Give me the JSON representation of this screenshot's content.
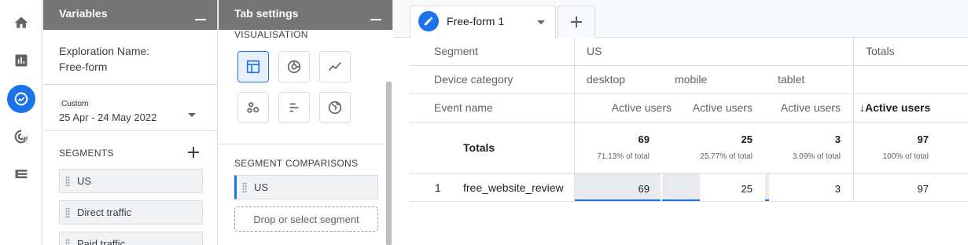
{
  "nav": {
    "items": [
      {
        "name": "home-icon"
      },
      {
        "name": "reports-icon"
      },
      {
        "name": "explore-icon",
        "active": true
      },
      {
        "name": "advertising-icon"
      },
      {
        "name": "configure-icon"
      }
    ]
  },
  "variables": {
    "title": "Variables",
    "exploration_name_label": "Exploration Name:",
    "exploration_name": "Free-form",
    "date_badge": "Custom",
    "date_range": "25 Apr - 24 May 2022",
    "segments_title": "SEGMENTS",
    "segments": [
      "US",
      "Direct traffic",
      "Paid traffic"
    ]
  },
  "tab_settings": {
    "title": "Tab settings",
    "visualisation_label": "VISUALISATION",
    "viz_buttons": [
      {
        "name": "table-viz-icon",
        "active": true
      },
      {
        "name": "donut-viz-icon"
      },
      {
        "name": "line-viz-icon"
      },
      {
        "name": "scatter-viz-icon"
      },
      {
        "name": "bar-viz-icon"
      },
      {
        "name": "geo-viz-icon"
      }
    ],
    "segment_comparisons_title": "SEGMENT COMPARISONS",
    "segment_comparison": "US",
    "drop_zone": "Drop or select segment"
  },
  "canvas": {
    "tab_label": "Free-form 1",
    "accent": "#1a73e8"
  },
  "table": {
    "row_dims": {
      "segment_label": "Segment",
      "device_label": "Device category",
      "event_label": "Event name"
    },
    "segment_value": "US",
    "totals_header": "Totals",
    "devices": [
      "desktop",
      "mobile",
      "tablet"
    ],
    "metric_headers": [
      "Active users",
      "Active users",
      "Active users",
      "↓Active users"
    ],
    "totals_label": "Totals",
    "totals": [
      {
        "value": "69",
        "pct": "71.13% of total"
      },
      {
        "value": "25",
        "pct": "25.77% of total"
      },
      {
        "value": "3",
        "pct": "3.09% of total"
      },
      {
        "value": "97",
        "pct": "100% of total"
      }
    ],
    "rows": [
      {
        "index": "1",
        "event": "free_website_review",
        "values": [
          "69",
          "25",
          "3",
          "97"
        ],
        "shares": [
          1.0,
          0.362,
          0.043,
          0
        ]
      }
    ]
  }
}
